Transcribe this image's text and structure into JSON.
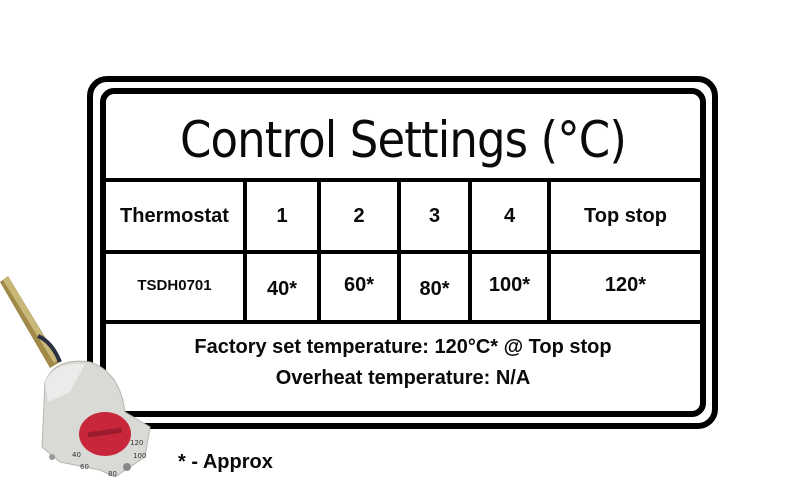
{
  "title": "Control Settings (°C)",
  "table": {
    "headers": [
      "Thermostat",
      "1",
      "2",
      "3",
      "4",
      "Top stop"
    ],
    "rows": [
      [
        "TSDH0701",
        "40*",
        "60*",
        "80*",
        "100*",
        "120*"
      ]
    ]
  },
  "footer": {
    "line1": "Factory set temperature:  120°C* @ Top stop",
    "line2": "Overheat temperature: N/A"
  },
  "footnote": "* - Approx",
  "product_image": {
    "description": "Thermostat with red dial",
    "dial_labels": [
      "40",
      "60",
      "80",
      "100",
      "120"
    ],
    "colors": {
      "body": "#d9d9d6",
      "dial": "#c8263a",
      "rod": "#a08a4a"
    }
  }
}
